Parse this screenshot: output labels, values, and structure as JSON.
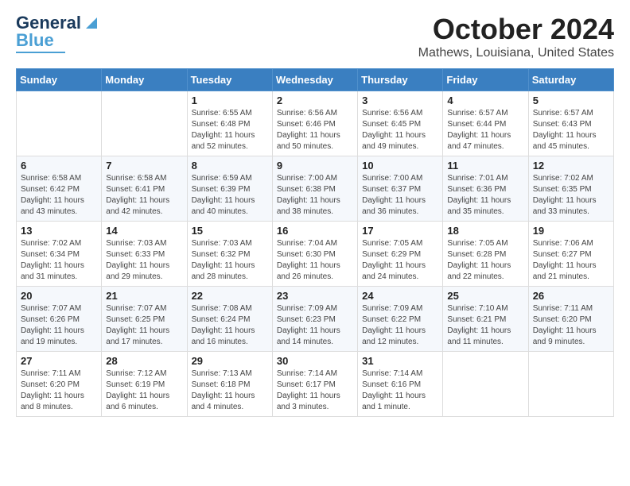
{
  "header": {
    "logo_line1": "General",
    "logo_line2": "Blue",
    "month_title": "October 2024",
    "location": "Mathews, Louisiana, United States"
  },
  "weekdays": [
    "Sunday",
    "Monday",
    "Tuesday",
    "Wednesday",
    "Thursday",
    "Friday",
    "Saturday"
  ],
  "weeks": [
    [
      {
        "day": "",
        "sunrise": "",
        "sunset": "",
        "daylight": ""
      },
      {
        "day": "",
        "sunrise": "",
        "sunset": "",
        "daylight": ""
      },
      {
        "day": "1",
        "sunrise": "Sunrise: 6:55 AM",
        "sunset": "Sunset: 6:48 PM",
        "daylight": "Daylight: 11 hours and 52 minutes."
      },
      {
        "day": "2",
        "sunrise": "Sunrise: 6:56 AM",
        "sunset": "Sunset: 6:46 PM",
        "daylight": "Daylight: 11 hours and 50 minutes."
      },
      {
        "day": "3",
        "sunrise": "Sunrise: 6:56 AM",
        "sunset": "Sunset: 6:45 PM",
        "daylight": "Daylight: 11 hours and 49 minutes."
      },
      {
        "day": "4",
        "sunrise": "Sunrise: 6:57 AM",
        "sunset": "Sunset: 6:44 PM",
        "daylight": "Daylight: 11 hours and 47 minutes."
      },
      {
        "day": "5",
        "sunrise": "Sunrise: 6:57 AM",
        "sunset": "Sunset: 6:43 PM",
        "daylight": "Daylight: 11 hours and 45 minutes."
      }
    ],
    [
      {
        "day": "6",
        "sunrise": "Sunrise: 6:58 AM",
        "sunset": "Sunset: 6:42 PM",
        "daylight": "Daylight: 11 hours and 43 minutes."
      },
      {
        "day": "7",
        "sunrise": "Sunrise: 6:58 AM",
        "sunset": "Sunset: 6:41 PM",
        "daylight": "Daylight: 11 hours and 42 minutes."
      },
      {
        "day": "8",
        "sunrise": "Sunrise: 6:59 AM",
        "sunset": "Sunset: 6:39 PM",
        "daylight": "Daylight: 11 hours and 40 minutes."
      },
      {
        "day": "9",
        "sunrise": "Sunrise: 7:00 AM",
        "sunset": "Sunset: 6:38 PM",
        "daylight": "Daylight: 11 hours and 38 minutes."
      },
      {
        "day": "10",
        "sunrise": "Sunrise: 7:00 AM",
        "sunset": "Sunset: 6:37 PM",
        "daylight": "Daylight: 11 hours and 36 minutes."
      },
      {
        "day": "11",
        "sunrise": "Sunrise: 7:01 AM",
        "sunset": "Sunset: 6:36 PM",
        "daylight": "Daylight: 11 hours and 35 minutes."
      },
      {
        "day": "12",
        "sunrise": "Sunrise: 7:02 AM",
        "sunset": "Sunset: 6:35 PM",
        "daylight": "Daylight: 11 hours and 33 minutes."
      }
    ],
    [
      {
        "day": "13",
        "sunrise": "Sunrise: 7:02 AM",
        "sunset": "Sunset: 6:34 PM",
        "daylight": "Daylight: 11 hours and 31 minutes."
      },
      {
        "day": "14",
        "sunrise": "Sunrise: 7:03 AM",
        "sunset": "Sunset: 6:33 PM",
        "daylight": "Daylight: 11 hours and 29 minutes."
      },
      {
        "day": "15",
        "sunrise": "Sunrise: 7:03 AM",
        "sunset": "Sunset: 6:32 PM",
        "daylight": "Daylight: 11 hours and 28 minutes."
      },
      {
        "day": "16",
        "sunrise": "Sunrise: 7:04 AM",
        "sunset": "Sunset: 6:30 PM",
        "daylight": "Daylight: 11 hours and 26 minutes."
      },
      {
        "day": "17",
        "sunrise": "Sunrise: 7:05 AM",
        "sunset": "Sunset: 6:29 PM",
        "daylight": "Daylight: 11 hours and 24 minutes."
      },
      {
        "day": "18",
        "sunrise": "Sunrise: 7:05 AM",
        "sunset": "Sunset: 6:28 PM",
        "daylight": "Daylight: 11 hours and 22 minutes."
      },
      {
        "day": "19",
        "sunrise": "Sunrise: 7:06 AM",
        "sunset": "Sunset: 6:27 PM",
        "daylight": "Daylight: 11 hours and 21 minutes."
      }
    ],
    [
      {
        "day": "20",
        "sunrise": "Sunrise: 7:07 AM",
        "sunset": "Sunset: 6:26 PM",
        "daylight": "Daylight: 11 hours and 19 minutes."
      },
      {
        "day": "21",
        "sunrise": "Sunrise: 7:07 AM",
        "sunset": "Sunset: 6:25 PM",
        "daylight": "Daylight: 11 hours and 17 minutes."
      },
      {
        "day": "22",
        "sunrise": "Sunrise: 7:08 AM",
        "sunset": "Sunset: 6:24 PM",
        "daylight": "Daylight: 11 hours and 16 minutes."
      },
      {
        "day": "23",
        "sunrise": "Sunrise: 7:09 AM",
        "sunset": "Sunset: 6:23 PM",
        "daylight": "Daylight: 11 hours and 14 minutes."
      },
      {
        "day": "24",
        "sunrise": "Sunrise: 7:09 AM",
        "sunset": "Sunset: 6:22 PM",
        "daylight": "Daylight: 11 hours and 12 minutes."
      },
      {
        "day": "25",
        "sunrise": "Sunrise: 7:10 AM",
        "sunset": "Sunset: 6:21 PM",
        "daylight": "Daylight: 11 hours and 11 minutes."
      },
      {
        "day": "26",
        "sunrise": "Sunrise: 7:11 AM",
        "sunset": "Sunset: 6:20 PM",
        "daylight": "Daylight: 11 hours and 9 minutes."
      }
    ],
    [
      {
        "day": "27",
        "sunrise": "Sunrise: 7:11 AM",
        "sunset": "Sunset: 6:20 PM",
        "daylight": "Daylight: 11 hours and 8 minutes."
      },
      {
        "day": "28",
        "sunrise": "Sunrise: 7:12 AM",
        "sunset": "Sunset: 6:19 PM",
        "daylight": "Daylight: 11 hours and 6 minutes."
      },
      {
        "day": "29",
        "sunrise": "Sunrise: 7:13 AM",
        "sunset": "Sunset: 6:18 PM",
        "daylight": "Daylight: 11 hours and 4 minutes."
      },
      {
        "day": "30",
        "sunrise": "Sunrise: 7:14 AM",
        "sunset": "Sunset: 6:17 PM",
        "daylight": "Daylight: 11 hours and 3 minutes."
      },
      {
        "day": "31",
        "sunrise": "Sunrise: 7:14 AM",
        "sunset": "Sunset: 6:16 PM",
        "daylight": "Daylight: 11 hours and 1 minute."
      },
      {
        "day": "",
        "sunrise": "",
        "sunset": "",
        "daylight": ""
      },
      {
        "day": "",
        "sunrise": "",
        "sunset": "",
        "daylight": ""
      }
    ]
  ]
}
